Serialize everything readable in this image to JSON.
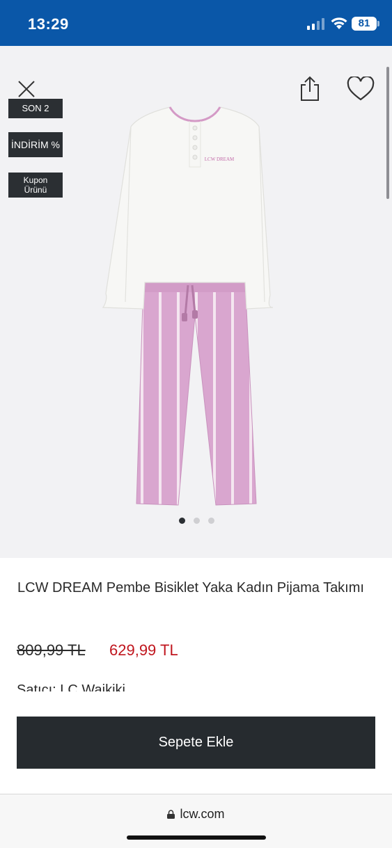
{
  "status_bar": {
    "time": "13:29",
    "battery": "81"
  },
  "badges": {
    "son": "SON 2",
    "indirim": "İNDİRİM %",
    "kupon_line1": "Kupon",
    "kupon_line2": "Ürünü"
  },
  "gallery": {
    "image_count": 3,
    "active_index": 0
  },
  "product": {
    "title": "LCW DREAM Pembe Bisiklet Yaka Kadın Pijama Takımı",
    "old_price": "809,99 TL",
    "new_price": "629,99 TL",
    "seller": "Satıcı: LC Waikiki",
    "tee_print": "LCW DREAM"
  },
  "actions": {
    "add_to_cart": "Sepete Ekle"
  },
  "browser": {
    "url": "lcw.com"
  },
  "colors": {
    "brand_blue": "#0a57a8",
    "price_red": "#c0161e",
    "button_dark": "#262b2f",
    "pants_pink": "#d9a6cf"
  }
}
